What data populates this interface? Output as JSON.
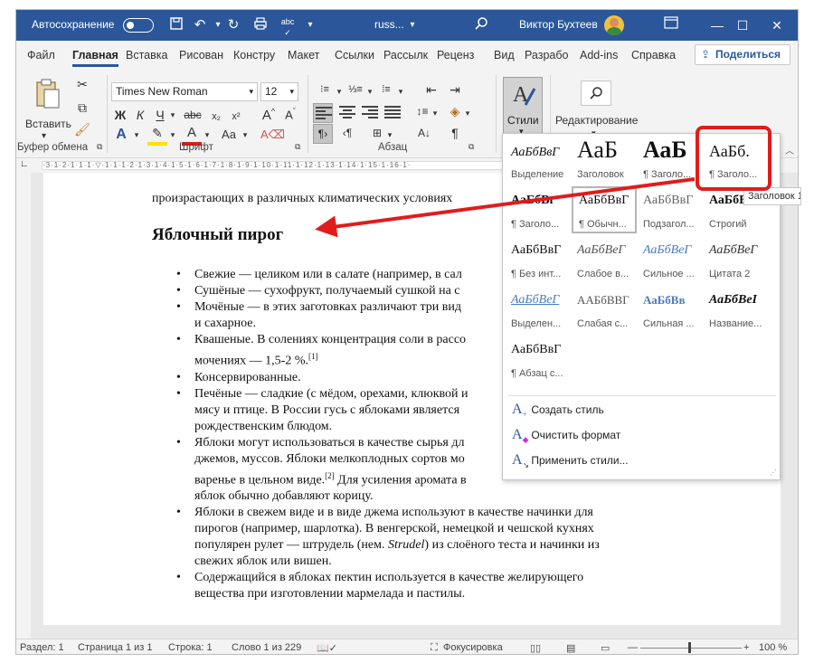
{
  "titlebar": {
    "autosave_label": "Автосохранение",
    "doc_name": "russ...",
    "user_name": "Виктор Бухтеев",
    "icons": [
      "save-icon",
      "undo-icon",
      "redo-icon",
      "print-icon",
      "spelling-icon",
      "search-icon",
      "minimize-icon",
      "maximize-icon",
      "close-icon"
    ]
  },
  "tabs": [
    "Файл",
    "Главная",
    "Вставка",
    "Рисован",
    "Констру",
    "Макет",
    "Ссылки",
    "Рассылк",
    "Реценз",
    "Вид",
    "Разрабо",
    "Add-ins",
    "Справка"
  ],
  "share_label": "Поделиться",
  "ribbon": {
    "clipboard": {
      "paste_label": "Вставить",
      "group_label": "Буфер обмена"
    },
    "font": {
      "font_name": "Times New Roman",
      "font_size": "12",
      "group_label": "Шрифт",
      "bold": "Ж",
      "italic": "К",
      "underline": "Ч"
    },
    "paragraph": {
      "group_label": "Абзац",
      "pilcrow": "¶"
    },
    "styles": {
      "label": "Стили"
    },
    "editing": {
      "label": "Редактирование"
    }
  },
  "document": {
    "prev_line": "произрастающих в различных климатических условиях",
    "heading": "Яблочный пирог",
    "bullets": [
      [
        "Свежие — целиком или в салате (например, в сал"
      ],
      [
        "Сушёные — сухофрукт, получаемый сушкой на с"
      ],
      [
        "Мочёные — в этих заготовках различают три вид",
        "и сахарное."
      ],
      [
        "Квашеные. В солениях концентрация соли в рассо",
        "мочениях — 1,5-2 %."
      ],
      [
        "Консервированные."
      ],
      [
        "Печёные — сладкие (с мёдом, орехами, клюквой и",
        "мясу и птице. В России гусь с яблоками является",
        "рождественским блюдом."
      ],
      [
        "Яблоки могут использоваться в качестве сырья дл",
        "джемов, муссов. Яблоки мелкоплодных сортов мо",
        "варенье в цельном виде.",
        "яблок обычно добавляют корицу."
      ],
      [
        "Яблоки в свежем виде и в виде джема используют в качестве начинки для",
        "пирогов (например, шарлотка). В венгерской, немецкой и чешской кухнях",
        "популярен рулет — штрудель (нем. ",
        "свежих яблок или вишен."
      ],
      [
        "Содержащийся в яблоках пектин используется в качестве желирующего",
        "вещества при изготовлении мармелада и пастилы."
      ]
    ],
    "footnote1": "[1]",
    "footnote2": "[2]",
    "after_fn2": " Для усиления аромата в",
    "strudel": "Strudel",
    "strudel_after": ") из слоёного теста и начинки из"
  },
  "gallery": {
    "styles": [
      {
        "preview": "АаБбВвГ",
        "name": "Выделение"
      },
      {
        "preview": "АаБ",
        "name": "Заголовок"
      },
      {
        "preview": "АаБ",
        "name": "¶ Заголо..."
      },
      {
        "preview": "АаБб.",
        "name": "¶ Заголо..."
      },
      {
        "preview": "АаБбВı",
        "name": "¶ Заголо..."
      },
      {
        "preview": "АаБбВвГ",
        "name": "¶ Обычн..."
      },
      {
        "preview": "АаБбВвГ",
        "name": "Подзагол..."
      },
      {
        "preview": "АаБбВвГ",
        "name": "Строгий"
      },
      {
        "preview": "АаБбВвГ",
        "name": "¶ Без инт..."
      },
      {
        "preview": "АаБбВеГ",
        "name": "Слабое в..."
      },
      {
        "preview": "АаБбВеГ",
        "name": "Сильное ..."
      },
      {
        "preview": "АаБбВеГ",
        "name": "Цитата 2"
      },
      {
        "preview": "АаБбВеГ",
        "name": "Выделен..."
      },
      {
        "preview": "ААБбВВГ",
        "name": "Слабая с..."
      },
      {
        "preview": "АаБбВв",
        "name": "Сильная ..."
      },
      {
        "preview": "АаБбВеІ",
        "name": "Название..."
      },
      {
        "preview": "АаБбВвГ",
        "name": "¶ Абзац с..."
      }
    ],
    "commands": [
      "Создать стиль",
      "Очистить формат",
      "Применить стили..."
    ]
  },
  "tooltip": "Заголовок 1",
  "status": {
    "section": "Раздел: 1",
    "page": "Страница 1 из 1",
    "line": "Строка: 1",
    "words": "Слово 1 из 229",
    "focus": "Фокусировка",
    "zoom": "100 %"
  },
  "colors": {
    "titlebar": "#2b579a",
    "annotation": "#e21b1b"
  }
}
